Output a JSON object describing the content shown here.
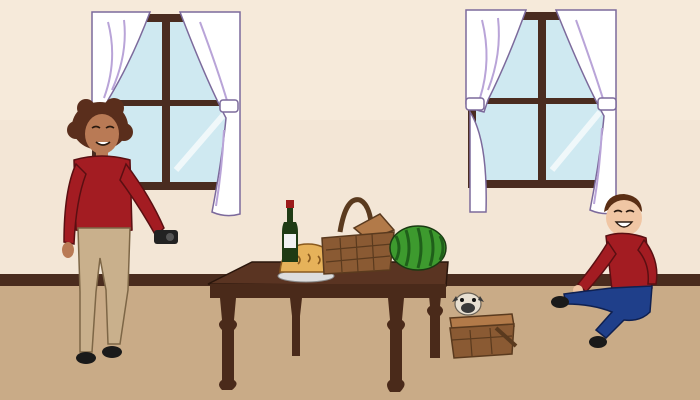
{
  "scene": {
    "colors": {
      "wall": "#f3e6d6",
      "wall_light": "#f8ecdc",
      "baseboard": "#4a2c1e",
      "floor": "#c9ab87",
      "window_frame": "#4a2c20",
      "glass": "#cfe9f1",
      "curtain": "#ffffff",
      "curtain_shade": "#b9a4d8",
      "table": "#4a2a1a",
      "table_top": "#5a3422",
      "shirt": "#a31c22",
      "pants_woman": "#c9b08c",
      "jeans": "#1f3f8a",
      "hair_woman": "#5a2e1c",
      "hair_boy": "#5a2e14",
      "skin_woman": "#b97a55",
      "skin_boy": "#f0c6a4",
      "basket": "#8a5a33",
      "basket_light": "#b27a49",
      "watermelon": "#3d9a2e",
      "watermelon_stripe": "#1f5f1a",
      "pie": "#e6b25a",
      "pie_dark": "#c98a33",
      "wine": "#1f3b14",
      "wine_label": "#f2f2f2",
      "wine_cap": "#9c1b1b",
      "camera": "#222222",
      "pug": "#e8e0d2",
      "pug_face": "#3a3a3a"
    },
    "objects": {
      "woman": "woman-with-camera",
      "boy": "laughing-boy",
      "table": "wooden-table",
      "pie": "pie",
      "wine": "wine-bottle",
      "basket": "picnic-basket",
      "watermelon": "watermelon",
      "pug": "pug-puppy",
      "floor_basket": "floor-picnic-basket"
    }
  }
}
